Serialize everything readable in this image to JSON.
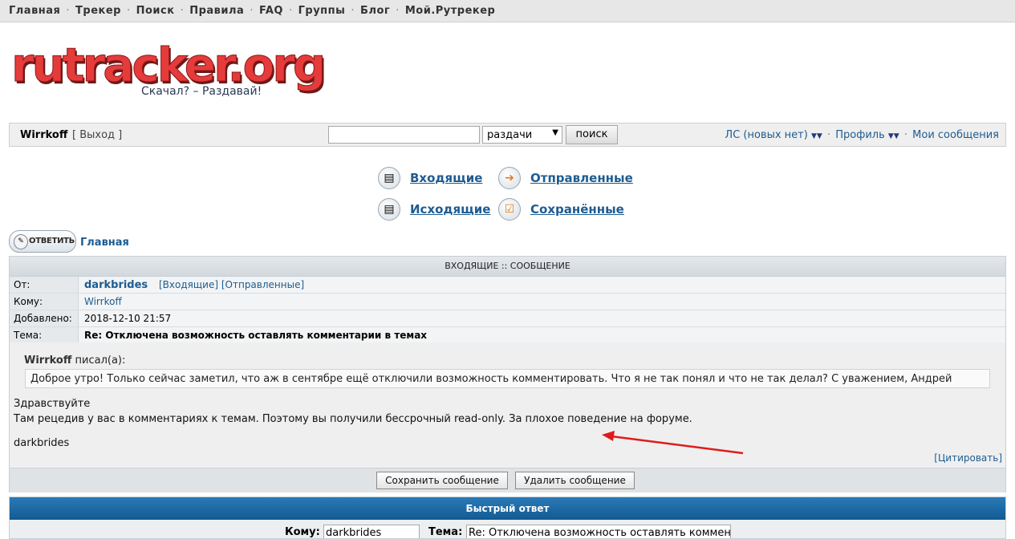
{
  "topnav": {
    "items": [
      "Главная",
      "Трекер",
      "Поиск",
      "Правила",
      "FAQ",
      "Группы",
      "Блог",
      "Мой.Рутрекер"
    ]
  },
  "logo": {
    "text": "rutracker.org",
    "tagline": "Скачал? – Раздавай!"
  },
  "userbar": {
    "username": "Wirrkoff",
    "logout": "[ Выход ]",
    "search_value": "",
    "search_scope": "раздачи",
    "search_button": "поиск",
    "pm_link": "ЛС (новых нет)",
    "profile_link": "Профиль",
    "my_posts_link": "Мои сообщения"
  },
  "pm_nav": {
    "inbox": "Входящие",
    "sent": "Отправленные",
    "outbox": "Исходящие",
    "saved": "Сохранённые"
  },
  "reply_button": "ОТВЕТИТЬ",
  "breadcrumb": "Главная",
  "message": {
    "header": "ВХОДЯЩИЕ :: СООБЩЕНИЕ",
    "from_label": "От:",
    "from_value": "darkbrides",
    "from_links": "[Входящие] [Отправленные]",
    "to_label": "Кому:",
    "to_value": "Wirrkoff",
    "date_label": "Добавлено:",
    "date_value": "2018-12-10 21:57",
    "subject_label": "Тема:",
    "subject_value": "Re: Отключена возможность оставлять комментарии в темах",
    "quote_author": "Wirrkoff",
    "quote_suffix": " писал(а):",
    "quote_text": "Доброе утро! Только сейчас заметил, что аж в сентябре ещё отключили возможность комментировать. Что я не так понял и что не так делал? С уважением, Андрей",
    "body_line1": "Здравствуйте",
    "body_line2": "Там рецедив у вас в комментариях к темам. Поэтому вы получили бессрочный read-only. За плохое поведение на форуме.",
    "signature": "darkbrides",
    "cite_link": "[Цитировать]",
    "save_button": "Сохранить сообщение",
    "delete_button": "Удалить сообщение"
  },
  "quick_reply": {
    "header": "Быстрый ответ",
    "to_label": "Кому:",
    "to_value": "darkbrides",
    "subject_label": "Тема:",
    "subject_value": "Re: Отключена возможность оставлять комментари"
  },
  "colors": {
    "link": "#1e5c91",
    "quick_header": "#1a6aa6",
    "annotation_arrow": "#e01b1b"
  }
}
